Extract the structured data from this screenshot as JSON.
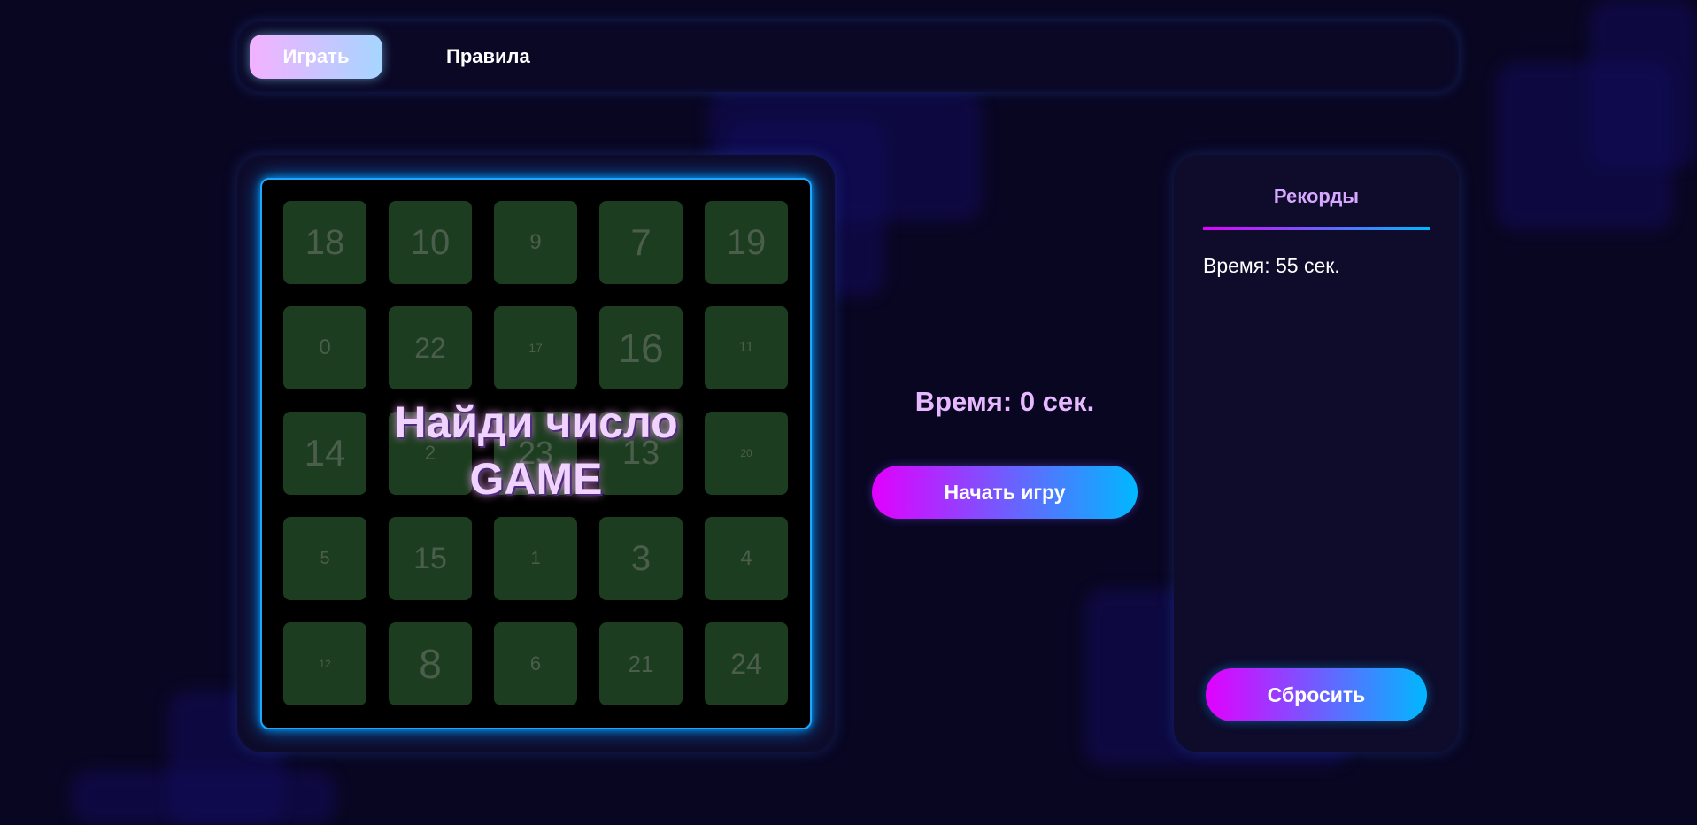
{
  "nav": {
    "tabs": [
      {
        "label": "Играть",
        "active": true
      },
      {
        "label": "Правила",
        "active": false
      }
    ]
  },
  "game": {
    "title_line1": "Найди число",
    "title_line2": "GAME",
    "cells": [
      {
        "n": "18",
        "s": 40
      },
      {
        "n": "10",
        "s": 40
      },
      {
        "n": "9",
        "s": 24
      },
      {
        "n": "7",
        "s": 42
      },
      {
        "n": "19",
        "s": 40
      },
      {
        "n": "0",
        "s": 24
      },
      {
        "n": "22",
        "s": 32
      },
      {
        "n": "17",
        "s": 14
      },
      {
        "n": "16",
        "s": 46
      },
      {
        "n": "11",
        "s": 16
      },
      {
        "n": "14",
        "s": 42
      },
      {
        "n": "2",
        "s": 22
      },
      {
        "n": "23",
        "s": 36
      },
      {
        "n": "13",
        "s": 38
      },
      {
        "n": "20",
        "s": 12
      },
      {
        "n": "5",
        "s": 20
      },
      {
        "n": "15",
        "s": 34
      },
      {
        "n": "1",
        "s": 20
      },
      {
        "n": "3",
        "s": 40
      },
      {
        "n": "4",
        "s": 24
      },
      {
        "n": "12",
        "s": 12
      },
      {
        "n": "8",
        "s": 46
      },
      {
        "n": "6",
        "s": 22
      },
      {
        "n": "21",
        "s": 26
      },
      {
        "n": "24",
        "s": 32
      }
    ],
    "timer": "Время: 0 сек.",
    "start_label": "Начать игру"
  },
  "records": {
    "title": "Рекорды",
    "items": [
      "Время: 55 сек."
    ],
    "reset_label": "Сбросить"
  },
  "colors": {
    "background": "#090622",
    "accent_start": "#e200ff",
    "accent_end": "#00b8ff",
    "cell": "#1d3d20"
  }
}
